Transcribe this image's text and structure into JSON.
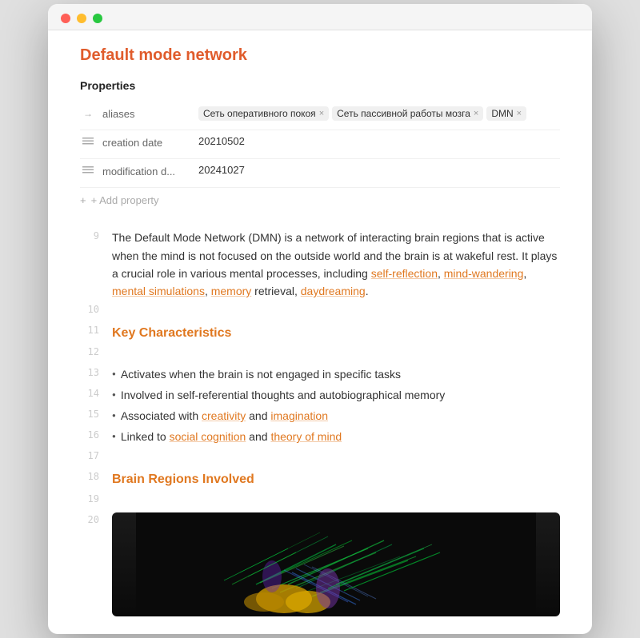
{
  "window": {
    "title": "Default mode network"
  },
  "traffic_lights": {
    "red": "red",
    "yellow": "yellow",
    "green": "green"
  },
  "page": {
    "title": "Default mode network"
  },
  "properties": {
    "heading": "Properties",
    "rows": [
      {
        "icon": "arrow-right",
        "name": "aliases",
        "type": "tags",
        "tags": [
          "Сеть оперативного покоя",
          "Сеть пассивной работы мозга",
          "DMN"
        ]
      },
      {
        "icon": "lines",
        "name": "creation date",
        "type": "text",
        "value": "20210502"
      },
      {
        "icon": "lines",
        "name": "modification d...",
        "type": "text",
        "value": "20241027"
      }
    ],
    "add_property_label": "+ Add property"
  },
  "editor": {
    "lines": [
      {
        "number": "9",
        "type": "paragraph",
        "text": "The Default Mode Network (DMN) is a network of interacting brain regions that is active when the mind is not focused on the outside world and the brain is at wakeful rest. It plays a crucial role in various mental processes, including ",
        "links": [
          {
            "text": "self-reflection",
            "href": "#"
          },
          {
            "text": "mind-wandering",
            "href": "#"
          },
          {
            "text": "mental simulations",
            "href": "#"
          },
          {
            "text": "memory",
            "href": "#"
          },
          {
            "text": "daydreaming",
            "href": "#"
          }
        ],
        "text_after_links": " retrieval, "
      },
      {
        "number": "10",
        "type": "empty"
      },
      {
        "number": "11",
        "type": "heading",
        "text": "Key Characteristics"
      },
      {
        "number": "12",
        "type": "empty"
      },
      {
        "number": "13",
        "type": "bullet",
        "text": "Activates when the brain is not engaged in specific tasks"
      },
      {
        "number": "14",
        "type": "bullet",
        "text": "Involved in self-referential thoughts and autobiographical memory"
      },
      {
        "number": "15",
        "type": "bullet",
        "text": "Associated with ",
        "link1": "creativity",
        "text2": " and ",
        "link2": "imagination"
      },
      {
        "number": "16",
        "type": "bullet",
        "text": "Linked to ",
        "link1": "social cognition",
        "text2": " and ",
        "link2": "theory of mind"
      },
      {
        "number": "17",
        "type": "empty"
      },
      {
        "number": "18",
        "type": "heading",
        "text": "Brain Regions Involved"
      },
      {
        "number": "19",
        "type": "empty"
      },
      {
        "number": "20",
        "type": "image"
      }
    ]
  }
}
